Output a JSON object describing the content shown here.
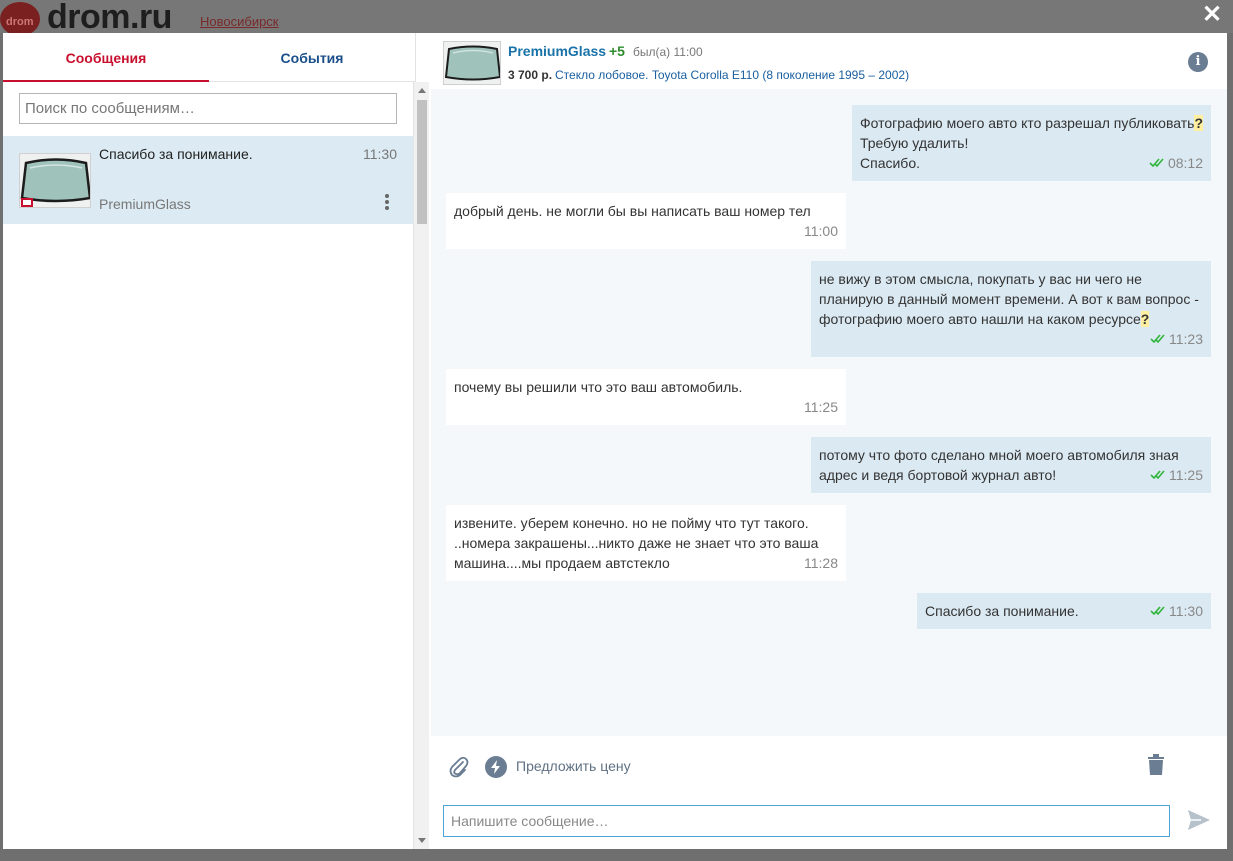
{
  "site": {
    "logo": "drom.ru",
    "logo_mark": "drom",
    "city": "Новосибирск"
  },
  "tabs": [
    {
      "label": "Сообщения",
      "active": true
    },
    {
      "label": "События",
      "active": false
    }
  ],
  "search": {
    "placeholder": "Поиск по сообщениям…",
    "value": ""
  },
  "conversation": {
    "last_message": "Спасибо за понимание.",
    "time": "11:30",
    "name": "PremiumGlass"
  },
  "chat_header": {
    "name": "PremiumGlass",
    "rating": "+5",
    "last_seen": "был(а) 11:00",
    "price": "3 700 р.",
    "item": "Стекло лобовое. Toyota Corolla E110 (8 поколение 1995 – 2002)"
  },
  "messages": [
    {
      "dir": "out",
      "lines": [
        "Фотографию моего авто кто разрешал публиковать",
        "Требую удалить!",
        "Спасибо."
      ],
      "mark": "?",
      "time": "08:12",
      "read": true
    },
    {
      "dir": "in",
      "text": "добрый день. не могли бы вы написать ваш номер тел",
      "time": "11:00"
    },
    {
      "dir": "out",
      "lines": [
        "не вижу в этом смысла, покупать у вас ни чего не",
        "планирую в данный момент времени. А вот к вам вопрос -",
        "фотографию моего авто нашли на каком ресурсе"
      ],
      "mark": "?",
      "time": "11:23",
      "read": true
    },
    {
      "dir": "in",
      "text": "почему вы решили что это ваш автомобиль.",
      "time": "11:25"
    },
    {
      "dir": "out",
      "lines": [
        "потому что фото сделано мной моего автомобиля зная",
        "адрес и ведя бортовой журнал авто!"
      ],
      "time": "11:25",
      "read": true
    },
    {
      "dir": "in",
      "lines": [
        "извените. уберем конечно. но не пойму что тут такого.",
        "..номера закрашены...никто даже не знает что это ваша",
        "машина....мы продаем автстекло"
      ],
      "time": "11:28"
    },
    {
      "dir": "out",
      "text": "Спасибо за понимание.",
      "time": "11:30",
      "read": true
    }
  ],
  "actions": {
    "offer_price": "Предложить цену"
  },
  "composer": {
    "placeholder": "Напишите сообщение…",
    "value": ""
  },
  "colors": {
    "accent_red": "#c8102e",
    "link_blue": "#1a73a8",
    "check_green": "#2fb53a",
    "out_bubble": "#dbe9f2"
  },
  "icons": [
    "close-icon",
    "paperclip-icon",
    "lightning-icon",
    "trash-icon",
    "send-icon",
    "info-icon",
    "more-vertical-icon"
  ]
}
